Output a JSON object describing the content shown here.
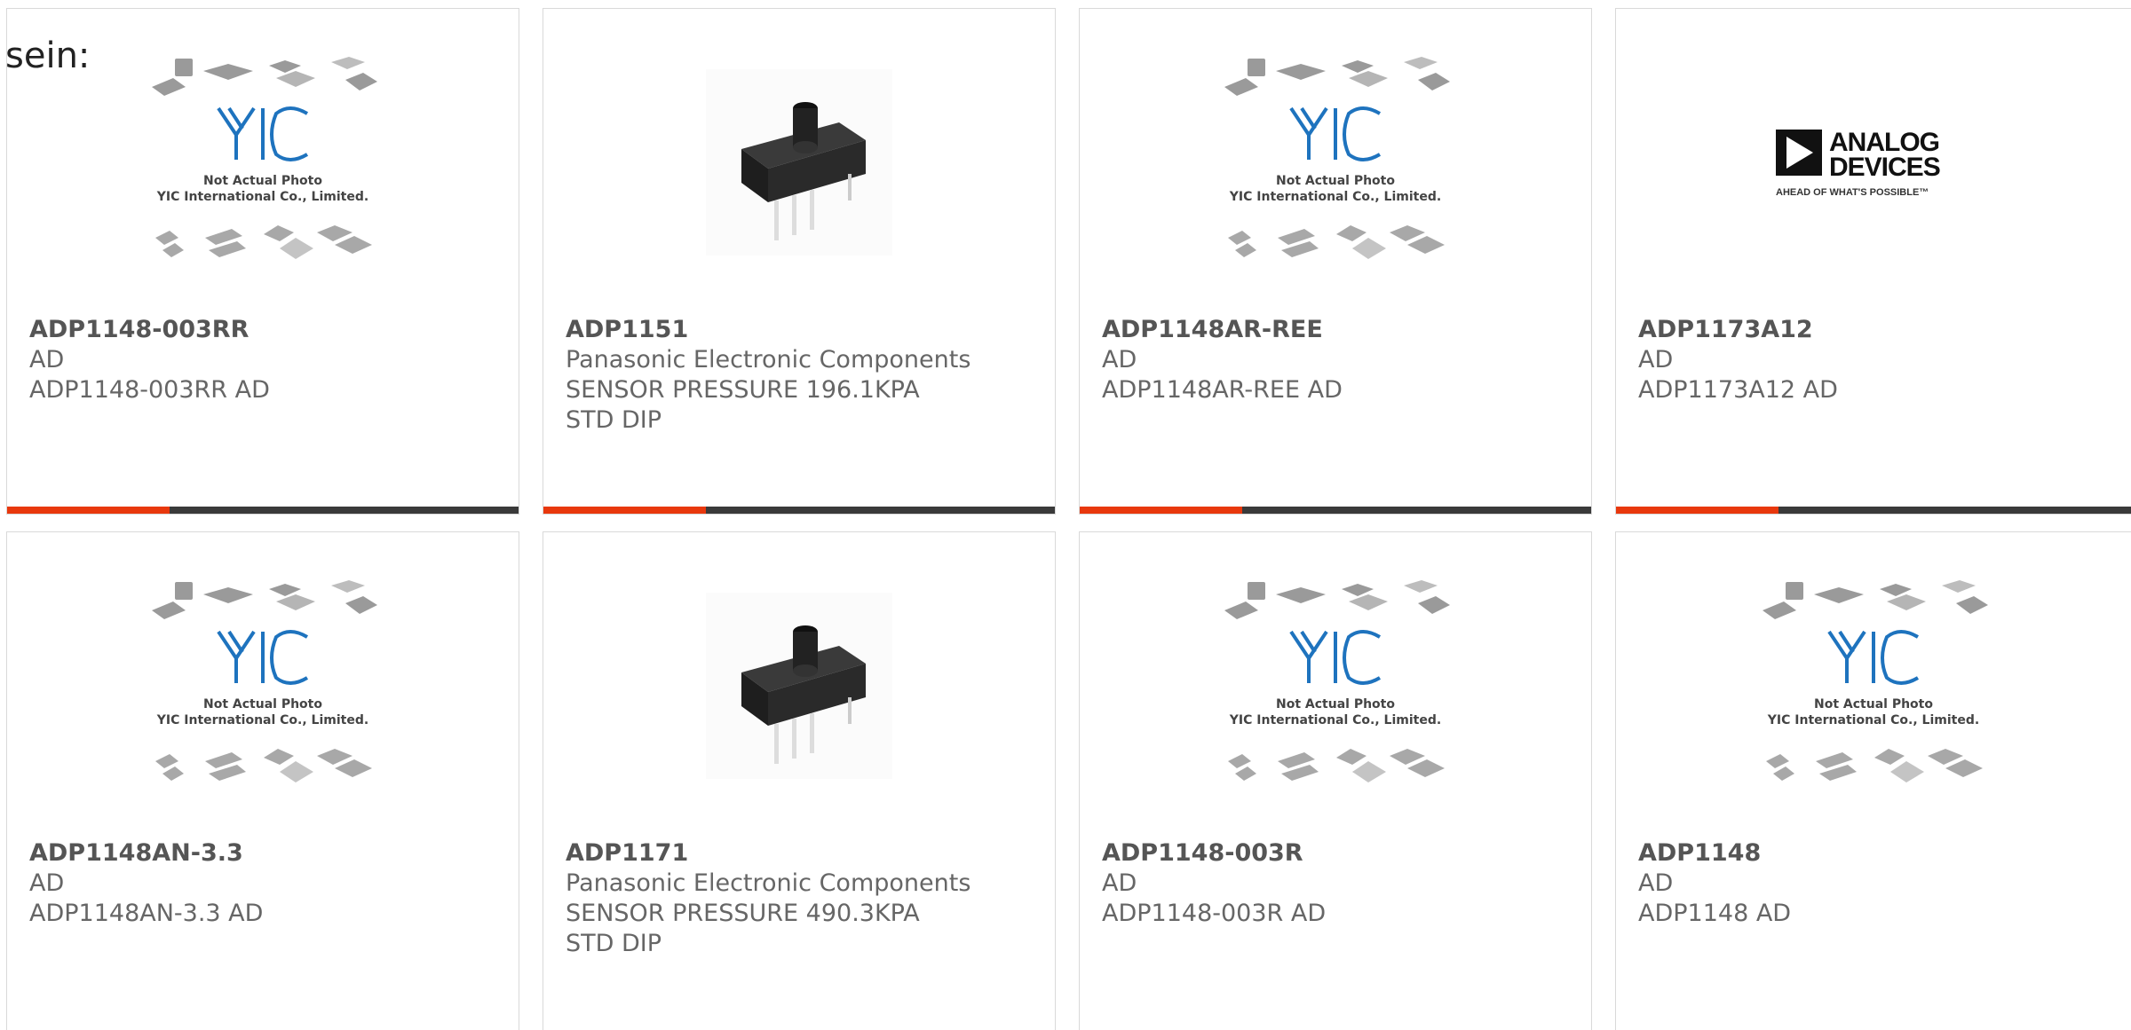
{
  "page": {
    "heading_fragment": "sein:"
  },
  "products": [
    {
      "part_number": "ADP1148-003RR",
      "manufacturer": "AD",
      "description": "ADP1148-003RR AD",
      "description2": "",
      "image": "placeholder"
    },
    {
      "part_number": "ADP1151",
      "manufacturer": "Panasonic Electronic Components",
      "description": "SENSOR PRESSURE 196.1KPA",
      "description2": "STD DIP",
      "image": "sensor"
    },
    {
      "part_number": "ADP1148AR-REE",
      "manufacturer": "AD",
      "description": "ADP1148AR-REE AD",
      "description2": "",
      "image": "placeholder"
    },
    {
      "part_number": "ADP1173A12",
      "manufacturer": "AD",
      "description": "ADP1173A12 AD",
      "description2": "",
      "image": "analog-devices-logo"
    },
    {
      "part_number": "ADP1148AN-3.3",
      "manufacturer": "AD",
      "description": "ADP1148AN-3.3 AD",
      "description2": "",
      "image": "placeholder"
    },
    {
      "part_number": "ADP1171",
      "manufacturer": "Panasonic Electronic Components",
      "description": "SENSOR PRESSURE 490.3KPA",
      "description2": "STD DIP",
      "image": "sensor"
    },
    {
      "part_number": "ADP1148-003R",
      "manufacturer": "AD",
      "description": "ADP1148-003R AD",
      "description2": "",
      "image": "placeholder"
    },
    {
      "part_number": "ADP1148",
      "manufacturer": "AD",
      "description": "ADP1148 AD",
      "description2": "",
      "image": "placeholder"
    }
  ],
  "placeholder_image": {
    "caption_line1": "Not Actual Photo",
    "caption_line2": "YIC International Co., Limited.",
    "logo_text": "YIC"
  },
  "adi_logo": {
    "line1": "ANALOG",
    "line2": "DEVICES",
    "tagline": "AHEAD OF WHAT'S POSSIBLE™"
  },
  "colors": {
    "accent": "#e8380d",
    "bar": "#3a3a3a",
    "yic_blue": "#1e73be"
  }
}
